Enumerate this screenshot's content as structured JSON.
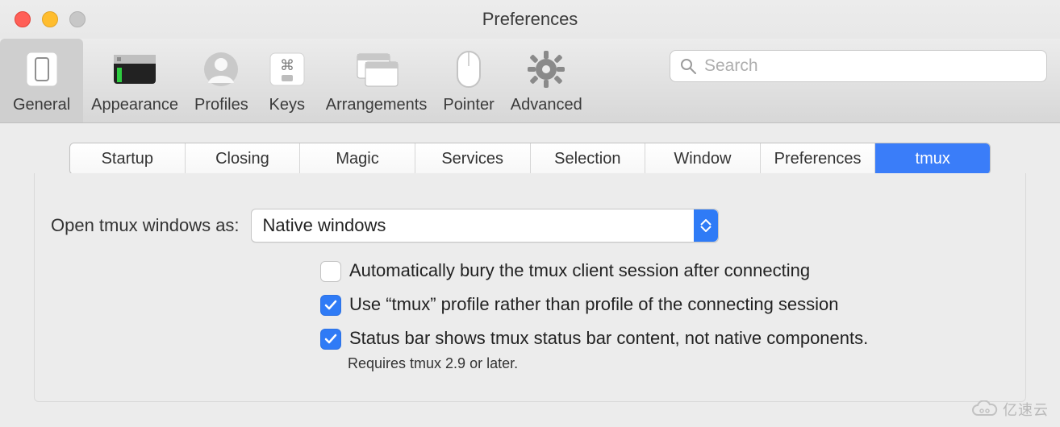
{
  "window": {
    "title": "Preferences"
  },
  "toolbar": {
    "items": [
      {
        "id": "general",
        "label": "General",
        "selected": true
      },
      {
        "id": "appearance",
        "label": "Appearance",
        "selected": false
      },
      {
        "id": "profiles",
        "label": "Profiles",
        "selected": false
      },
      {
        "id": "keys",
        "label": "Keys",
        "selected": false
      },
      {
        "id": "arrangements",
        "label": "Arrangements",
        "selected": false
      },
      {
        "id": "pointer",
        "label": "Pointer",
        "selected": false
      },
      {
        "id": "advanced",
        "label": "Advanced",
        "selected": false
      }
    ],
    "search_placeholder": "Search"
  },
  "tabs": {
    "items": [
      {
        "id": "startup",
        "label": "Startup",
        "selected": false
      },
      {
        "id": "closing",
        "label": "Closing",
        "selected": false
      },
      {
        "id": "magic",
        "label": "Magic",
        "selected": false
      },
      {
        "id": "services",
        "label": "Services",
        "selected": false
      },
      {
        "id": "selection",
        "label": "Selection",
        "selected": false
      },
      {
        "id": "window",
        "label": "Window",
        "selected": false
      },
      {
        "id": "preferences",
        "label": "Preferences",
        "selected": false
      },
      {
        "id": "tmux",
        "label": "tmux",
        "selected": true
      }
    ]
  },
  "settings": {
    "open_as_label": "Open tmux windows as:",
    "open_as_value": "Native windows",
    "checks": [
      {
        "id": "auto_bury",
        "label": "Automatically bury the tmux client session after connecting",
        "checked": false
      },
      {
        "id": "tmux_profile",
        "label": "Use “tmux” profile rather than profile of the connecting session",
        "checked": true
      },
      {
        "id": "status_bar",
        "label": "Status bar shows tmux status bar content, not native components.",
        "checked": true
      }
    ],
    "status_bar_sub": "Requires tmux 2.9 or later."
  },
  "watermark": {
    "text": "亿速云"
  },
  "colors": {
    "accent": "#2f7bf6"
  }
}
